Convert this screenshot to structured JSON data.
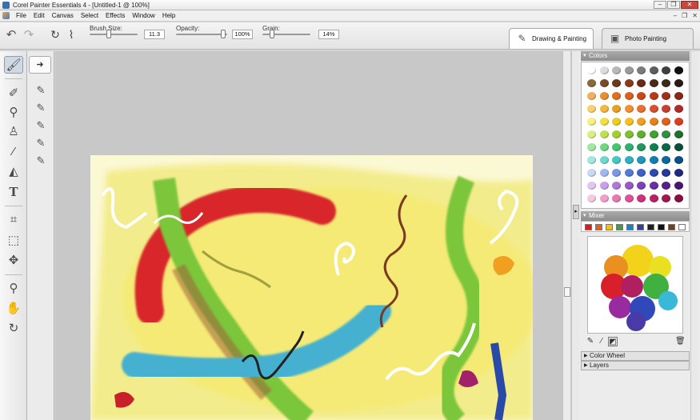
{
  "window": {
    "title": "Corel Painter Essentials 4 - [Untitled-1 @ 100%]",
    "buttons": [
      "–",
      "❐",
      "✕"
    ]
  },
  "menu": {
    "items": [
      "File",
      "Edit",
      "Canvas",
      "Select",
      "Effects",
      "Window",
      "Help"
    ],
    "doc_controls": [
      "–",
      "❐",
      "✕"
    ]
  },
  "property_bar": {
    "brush_size": {
      "label": "Brush Size:",
      "value": "11.3"
    },
    "opacity": {
      "label": "Opacity:",
      "value": "100%"
    },
    "grain": {
      "label": "Grain:",
      "value": "14%"
    }
  },
  "modes": [
    {
      "label": "Drawing & Painting",
      "active": true
    },
    {
      "label": "Photo Painting",
      "active": false
    }
  ],
  "panels": {
    "colors": {
      "title": "Colors"
    },
    "mixer": {
      "title": "Mixer"
    },
    "color_wheel": {
      "title": "Color Wheel"
    },
    "layers": {
      "title": "Layers"
    }
  },
  "palette": [
    [
      "#ffffff",
      "#dcdcdc",
      "#b8b8b8",
      "#9a9a9a",
      "#7c7c7c",
      "#5e5e5e",
      "#404040",
      "#111111"
    ],
    [
      "#8a6a3a",
      "#7a4a2a",
      "#6a3a1a",
      "#8a3a1a",
      "#6a2a1a",
      "#4a2a1a",
      "#3a2a1a",
      "#2a1a10"
    ],
    [
      "#f0b060",
      "#e89030",
      "#e07020",
      "#d86020",
      "#c84a1a",
      "#b83a18",
      "#a03018",
      "#882818"
    ],
    [
      "#f8d070",
      "#f0b840",
      "#e8a020",
      "#f09030",
      "#e87030",
      "#d85030",
      "#c84030",
      "#b02a28"
    ],
    [
      "#f8f080",
      "#f0e040",
      "#e8d020",
      "#f8c020",
      "#f0a020",
      "#e88020",
      "#e06020",
      "#d84020"
    ],
    [
      "#d8f080",
      "#c0e050",
      "#a0d030",
      "#80c030",
      "#60b030",
      "#40a030",
      "#309040",
      "#207030"
    ],
    [
      "#a0e8a0",
      "#70d880",
      "#40c870",
      "#30b070",
      "#209860",
      "#108050",
      "#0a6848",
      "#085038"
    ],
    [
      "#a0e8e0",
      "#70d8d0",
      "#40c8c8",
      "#30b0c0",
      "#2098b8",
      "#1080b0",
      "#0868a0",
      "#085088"
    ],
    [
      "#c8d8f8",
      "#a0b8f0",
      "#7898e8",
      "#5878d8",
      "#4060c8",
      "#3048b0",
      "#283898",
      "#202880"
    ],
    [
      "#e0c8f0",
      "#c8a0e8",
      "#b078d8",
      "#9858c8",
      "#8040b8",
      "#6830a0",
      "#582088",
      "#481870"
    ],
    [
      "#f8c8e0",
      "#f0a0c8",
      "#e878b0",
      "#e05098",
      "#d03080",
      "#b82068",
      "#a01850",
      "#881040"
    ]
  ],
  "mixer_colors": [
    "#d02020",
    "#e06020",
    "#f0c020",
    "#40a040",
    "#2080c0",
    "#3040a0",
    "#202020",
    "#101010",
    "#704020",
    "#ffffff"
  ],
  "icons": {
    "undo": "↶",
    "redo": "↷",
    "arrow": "➜",
    "tools": [
      "brush-icon",
      "eraser-icon",
      "dropper-blend-icon",
      "stamp-icon",
      "eyedropper-icon",
      "bucket-icon",
      "text-icon",
      "crop-icon",
      "rect-select-icon",
      "transform-icon",
      "magnifier-icon",
      "hand-icon",
      "rotate-icon"
    ]
  }
}
